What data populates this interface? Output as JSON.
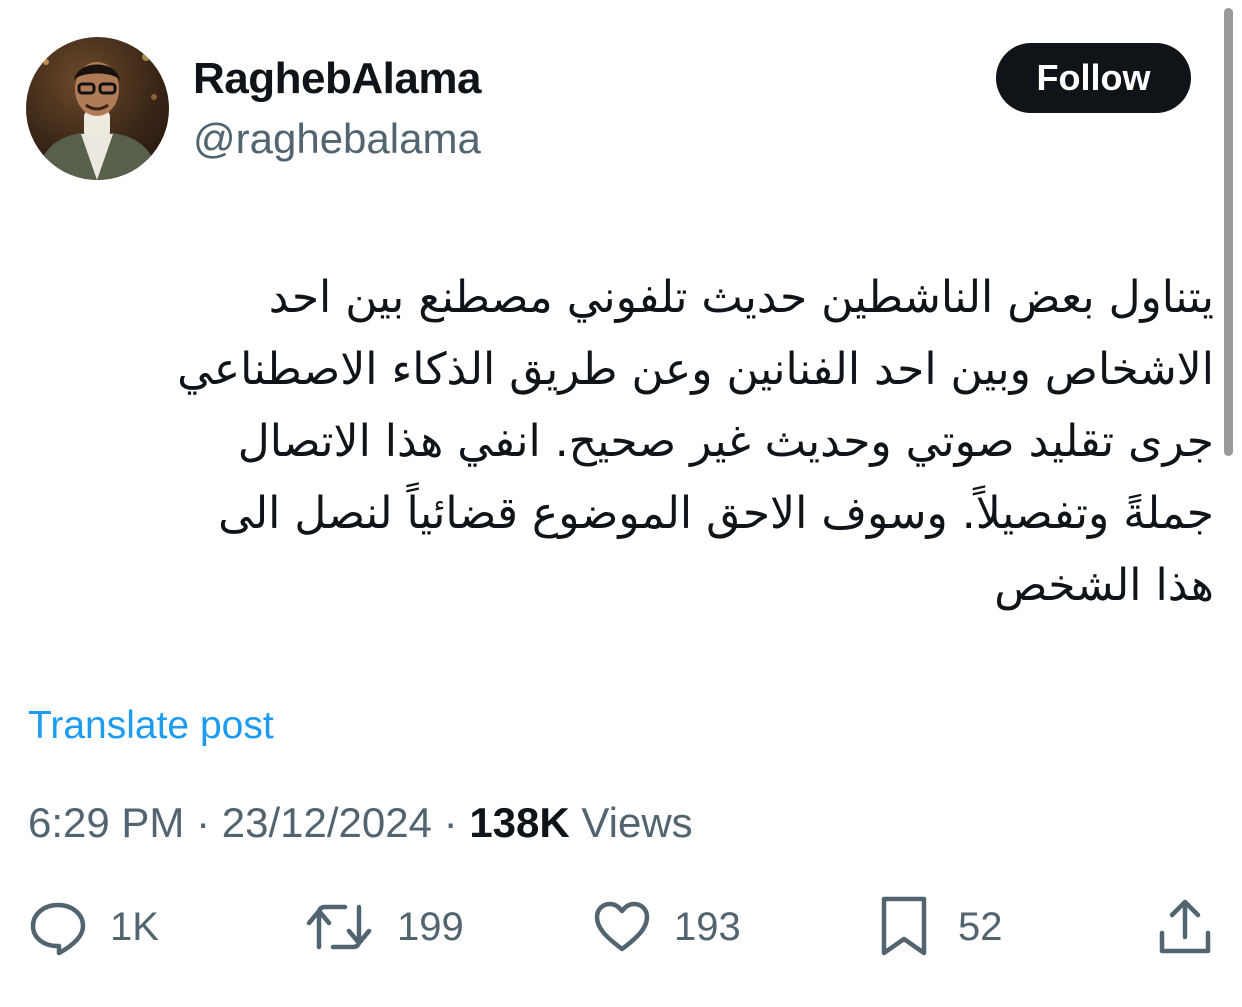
{
  "author": {
    "display_name": "RaghebAlama",
    "handle": "@raghebalama"
  },
  "follow_button": {
    "label": "Follow"
  },
  "tweet": {
    "text": "يتناول بعض الناشطين حديث تلفوني مصطنع بين احد\nالاشخاص وبين احد الفنانين وعن طريق الذكاء الاصطناعي\nجرى تقليد صوتي وحديث غير صحيح.  انفي هذا الاتصال\nجملةً وتفصيلاً.  وسوف الاحق الموضوع قضائياً لنصل الى\nهذا الشخص",
    "translate_label": "Translate post",
    "time": "6:29 PM",
    "separator": "·",
    "date": "23/12/2024",
    "views_count": "138K",
    "views_label": "Views"
  },
  "actions": {
    "replies": "1K",
    "reposts": "199",
    "likes": "193",
    "bookmarks": "52"
  },
  "icons": {
    "reply": "reply-icon",
    "repost": "repost-icon",
    "like": "heart-icon",
    "bookmark": "bookmark-icon",
    "share": "share-icon"
  },
  "colors": {
    "text": "#0f1419",
    "secondary": "#536471",
    "link": "#1d9bf0",
    "button_bg": "#0f1419"
  }
}
